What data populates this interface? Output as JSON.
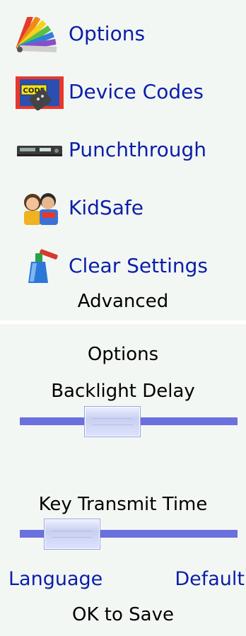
{
  "menu": {
    "items": [
      {
        "label": "Options",
        "icon": "color-swatch-icon"
      },
      {
        "label": "Device Codes",
        "icon": "code-remote-icon"
      },
      {
        "label": "Punchthrough",
        "icon": "av-receiver-icon"
      },
      {
        "label": "KidSafe",
        "icon": "children-icon"
      },
      {
        "label": "Clear Settings",
        "icon": "spray-bottle-icon"
      }
    ],
    "section_title": "Advanced"
  },
  "options_screen": {
    "title": "Options",
    "backlight": {
      "label": "Backlight Delay",
      "value_fraction": 0.4
    },
    "key_transmit": {
      "label": "Key Transmit Time",
      "value_fraction": 0.15
    },
    "softkeys": {
      "left": "Language",
      "right": "Default"
    },
    "hint": "OK to Save"
  },
  "colors": {
    "accent_text": "#0b1ea8",
    "slider_track": "#6a70de",
    "panel_bg": "#f3f7f4"
  }
}
